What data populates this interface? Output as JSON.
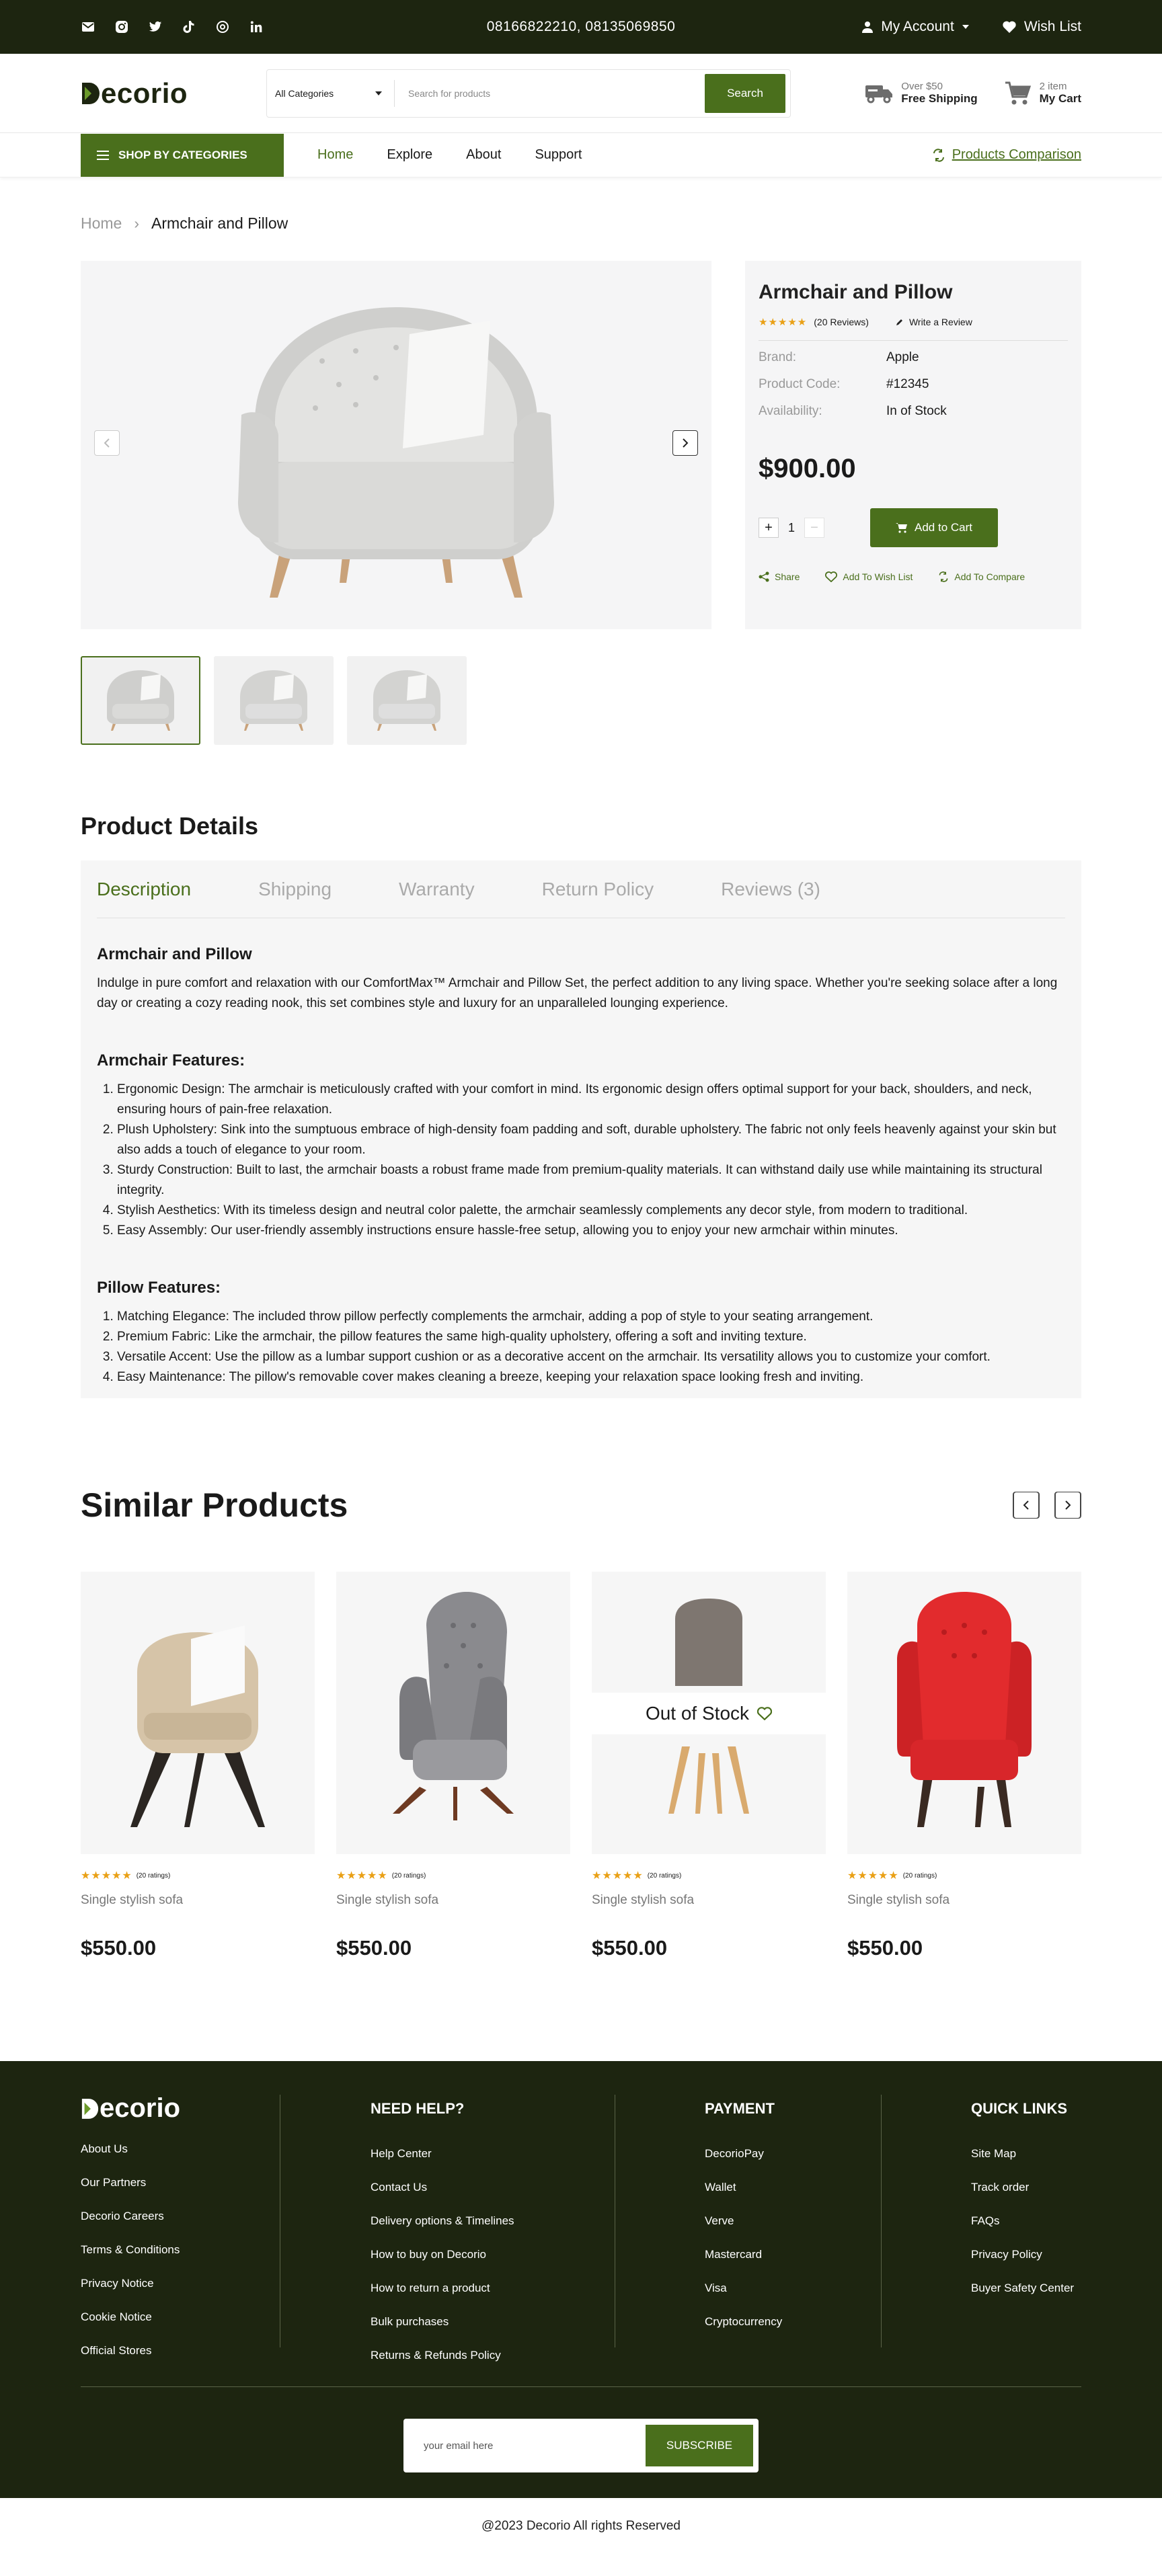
{
  "topbar": {
    "socials": [
      "mail-icon",
      "instagram-icon",
      "twitter-icon",
      "tiktok-icon",
      "threads-icon",
      "linkedin-icon"
    ],
    "phones": "08166822210,  08135069850",
    "account_label": "My Account",
    "wishlist_label": "Wish List"
  },
  "header": {
    "logo_rest": "ecorio",
    "category_select": "All Categories",
    "search_placeholder": "Search for products",
    "search_button": "Search",
    "shipping_small": "Over $50",
    "shipping_big": "Free Shipping",
    "cart_small": "2 item",
    "cart_big": "My Cart"
  },
  "nav": {
    "categories_button": "SHOP BY CATEGORIES",
    "links": [
      "Home",
      "Explore",
      "About",
      "Support"
    ],
    "compare": "Products Comparison"
  },
  "breadcrumb": {
    "home": "Home",
    "sep": "›",
    "current": "Armchair and Pillow"
  },
  "product": {
    "title": "Armchair and Pillow",
    "stars": "★★★★★",
    "reviews": "(20 Reviews)",
    "write_review": "Write a Review",
    "attributes": [
      {
        "k": "Brand:",
        "v": "Apple"
      },
      {
        "k": "Product Code:",
        "v": "#12345"
      },
      {
        "k": "Availability:",
        "v": "In of Stock"
      }
    ],
    "price": "$900.00",
    "quantity": "1",
    "add_to_cart": "Add to Cart",
    "actions": [
      "Share",
      "Add To Wish List",
      "Add To Compare"
    ]
  },
  "details": {
    "heading": "Product Details",
    "tabs": [
      "Description",
      "Shipping",
      "Warranty",
      "Return Policy",
      "Reviews (3)"
    ],
    "title": "Armchair and Pillow",
    "intro": "Indulge in pure comfort and relaxation with our ComfortMax™ Armchair and Pillow Set, the perfect addition to any living space. Whether you're seeking solace after a long day or creating a cozy reading nook, this set combines style and luxury for an unparalleled lounging experience.",
    "armchair_heading": "Armchair Features:",
    "armchair_features": [
      "Ergonomic Design: The armchair is meticulously crafted with your comfort in mind. Its ergonomic design offers optimal support for your back, shoulders, and neck, ensuring hours of pain-free relaxation.",
      "Plush Upholstery: Sink into the sumptuous embrace of high-density foam padding and soft, durable upholstery. The fabric not only feels heavenly against your skin but also adds a touch of elegance to your room.",
      "Sturdy Construction: Built to last, the armchair boasts a robust frame made from premium-quality materials. It can withstand daily use while maintaining its structural integrity.",
      "Stylish Aesthetics: With its timeless design and neutral color palette, the armchair seamlessly complements any decor style, from modern to traditional.",
      "Easy Assembly: Our user-friendly assembly instructions ensure hassle-free setup, allowing you to enjoy your new armchair within minutes."
    ],
    "pillow_heading": "Pillow Features:",
    "pillow_features": [
      "Matching Elegance: The included throw pillow perfectly complements the armchair, adding a pop of style to your seating arrangement.",
      "Premium Fabric: Like the armchair, the pillow features the same high-quality upholstery, offering a soft and inviting texture.",
      "Versatile Accent: Use the pillow as a lumbar support cushion or as a decorative accent on the armchair. Its versatility allows you to customize your comfort.",
      "Easy Maintenance: The pillow's removable cover makes cleaning a breeze, keeping your relaxation space looking fresh and inviting."
    ]
  },
  "similar": {
    "heading": "Similar Products",
    "out_of_stock": "Out of Stock",
    "products": [
      {
        "stars": "★★★★★",
        "ratings": "(20 ratings)",
        "name": "Single stylish sofa",
        "price": "$550.00"
      },
      {
        "stars": "★★★★★",
        "ratings": "(20 ratings)",
        "name": "Single stylish sofa",
        "price": "$550.00"
      },
      {
        "stars": "★★★★★",
        "ratings": "(20 ratings)",
        "name": "Single stylish sofa",
        "price": "$550.00"
      },
      {
        "stars": "★★★★★",
        "ratings": "(20 ratings)",
        "name": "Single stylish sofa",
        "price": "$550.00"
      }
    ]
  },
  "footer": {
    "logo_rest": "ecorio",
    "about_links": [
      "About Us",
      "Our Partners",
      "Decorio Careers",
      "Terms & Conditions",
      "Privacy Notice",
      "Cookie Notice",
      "Official Stores"
    ],
    "help_heading": "NEED HELP?",
    "help_links": [
      "Help Center",
      "Contact Us",
      "Delivery options & Timelines",
      "How to buy on Decorio",
      "How to return a product",
      "Bulk purchases",
      "Returns & Refunds Policy"
    ],
    "payment_heading": "PAYMENT",
    "payment_links": [
      "DecorioPay",
      "Wallet",
      "Verve",
      "Mastercard",
      "Visa",
      "Cryptocurrency"
    ],
    "quick_heading": "QUICK LINKS",
    "quick_links": [
      "Site Map",
      "Track order",
      "FAQs",
      "Privacy Policy",
      "Buyer Safety Center"
    ],
    "email_placeholder": "your email here",
    "subscribe": "SUBSCRIBE",
    "copyright": "@2023 Decorio All rights Reserved"
  },
  "colors": {
    "brand": "#4a6f1c",
    "dark": "#1d2510",
    "star": "#e9a016"
  }
}
